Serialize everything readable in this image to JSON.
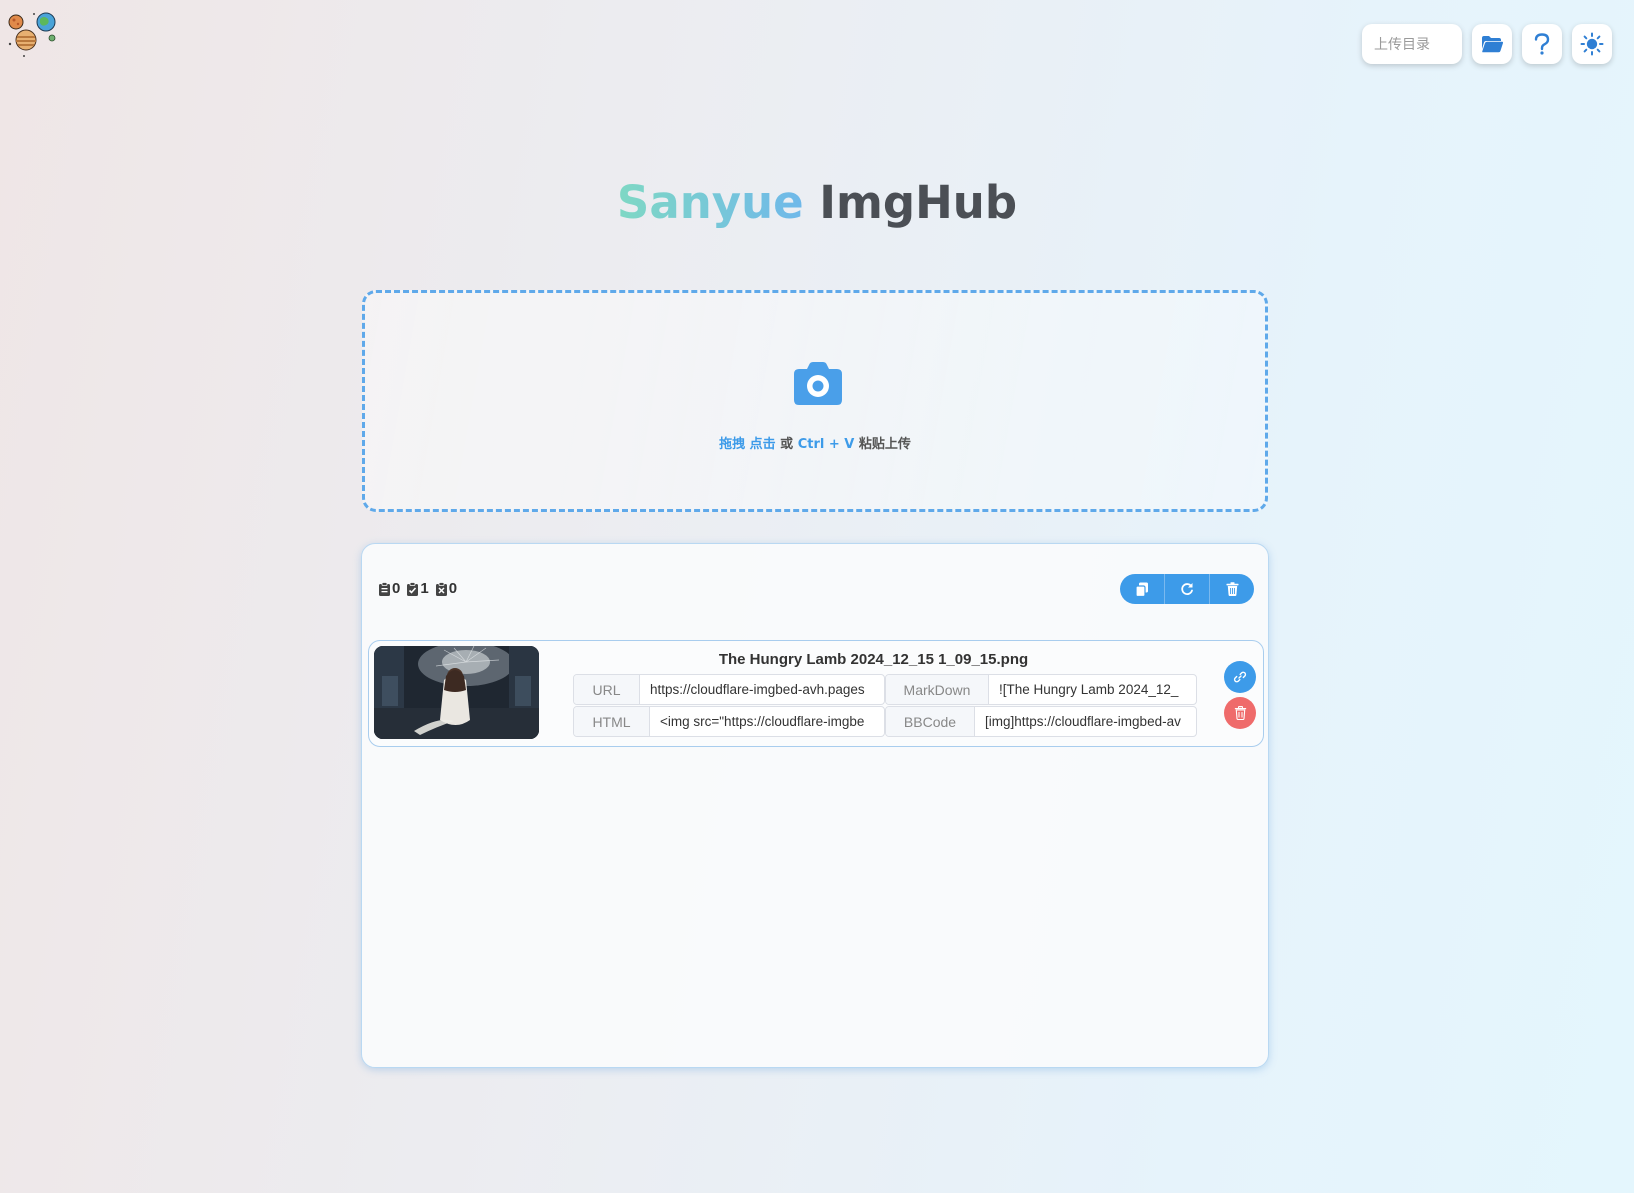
{
  "header": {
    "upload_dir_placeholder": "上传目录",
    "icons": [
      "folder-open-icon",
      "question-icon",
      "sun-icon"
    ]
  },
  "title": {
    "part1": "Sanyue",
    "part2": "ImgHub"
  },
  "dropzone": {
    "drag": "拖拽",
    "click": "点击",
    "or": "或",
    "shortcut": "Ctrl + V",
    "paste_upload": "粘贴上传"
  },
  "stats": {
    "pending": "0",
    "done": "1",
    "failed": "0"
  },
  "file": {
    "name": "The Hungry Lamb 2024_12_15 1_09_15.png",
    "links": [
      {
        "label": "URL",
        "value": "https://cloudflare-imgbed-avh.pages"
      },
      {
        "label": "MarkDown",
        "value": "![The Hungry Lamb 2024_12_"
      },
      {
        "label": "HTML",
        "value": "<img src=\"https://cloudflare-imgbe"
      },
      {
        "label": "BBCode",
        "value": "[img]https://cloudflare-imgbed-av"
      }
    ]
  },
  "colors": {
    "accent": "#3d9be9",
    "danger": "#ef6b6b",
    "title_dark": "#4b4f55"
  }
}
